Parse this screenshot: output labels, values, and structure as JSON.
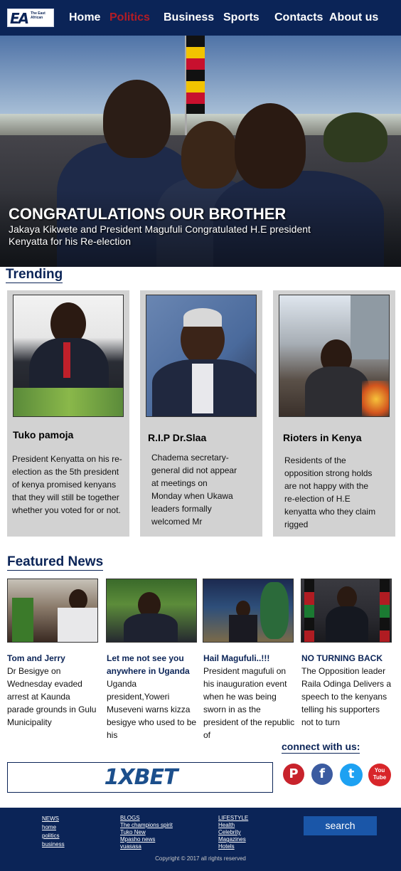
{
  "logo": {
    "letters": "EA",
    "tagline": "The East African"
  },
  "nav": [
    {
      "label": "Home"
    },
    {
      "label": "Politics"
    },
    {
      "label": "Business"
    },
    {
      "label": "Sports"
    },
    {
      "label": "Contacts"
    },
    {
      "label": "About us"
    }
  ],
  "hero": {
    "title": "CONGRATULATIONS OUR BROTHER",
    "subtitle": "Jakaya Kikwete and President Magufuli Congratulated H.E president Kenyatta for his Re-election"
  },
  "trending": {
    "heading": "Trending",
    "items": [
      {
        "title": "Tuko pamoja",
        "text": "President Kenyatta on his re-election as the 5th  president of kenya promised kenyans that they will still be together whether you voted for or not."
      },
      {
        "title": "R.I.P Dr.Slaa",
        "text": "Chadema secretary-general did not appear at meetings on Monday when Ukawa leaders formally welcomed Mr"
      },
      {
        "title": "Rioters in Kenya",
        "text": "Residents of the opposition strong holds are not happy with the re-election of H.E kenyatta who they claim rigged"
      }
    ]
  },
  "featured": {
    "heading": "Featured News",
    "items": [
      {
        "title": "Tom and Jerry",
        "text": "Dr Besigye on Wednesday evaded arrest at Kaunda parade grounds in Gulu Municipality"
      },
      {
        "title": "Let me not see you anywhere in Uganda",
        "text": "Uganda president,Yoweri Museveni warns kizza besigye who used to be his"
      },
      {
        "title": "Hail Magufuli..!!!",
        "text": "President magufuli on his inauguration event when he was being sworn in as the president of the republic of"
      },
      {
        "title": "NO TURNING BACK",
        "text": "The Opposition leader Raila Odinga Delivers a speech to the kenyans telling his supporters not to turn"
      }
    ]
  },
  "connect": {
    "heading": "connect with us:"
  },
  "ad": {
    "text": "1XBET"
  },
  "social": [
    {
      "icon": "pinterest-icon",
      "glyph": "P",
      "color": "#c8232c"
    },
    {
      "icon": "facebook-icon",
      "glyph": "f",
      "color": "#3b5ba0"
    },
    {
      "icon": "twitter-icon",
      "glyph": "t",
      "color": "#1da1f2"
    },
    {
      "icon": "youtube-icon",
      "glyph": "You Tube",
      "color": "#d8262a"
    }
  ],
  "footer": {
    "news": {
      "heading": "NEWS",
      "links": [
        "home",
        "politics",
        "business"
      ]
    },
    "blogs": {
      "heading": "BLOGS",
      "links": [
        "The champions spirit",
        "Tuko New",
        "Mpasho news",
        "vuasasa"
      ]
    },
    "lifestyle": {
      "heading": "LIFESTYLE",
      "links": [
        "Health",
        "Celebrity",
        "Magazines",
        "Hotels"
      ]
    },
    "search_label": "search",
    "copyright": "Copyright © 2017 all rights reserved"
  },
  "colors": {
    "primary": "#0b2457",
    "active_nav": "#b41c24",
    "card_bg": "#d2d2d2",
    "search_button": "#1a56a8"
  }
}
